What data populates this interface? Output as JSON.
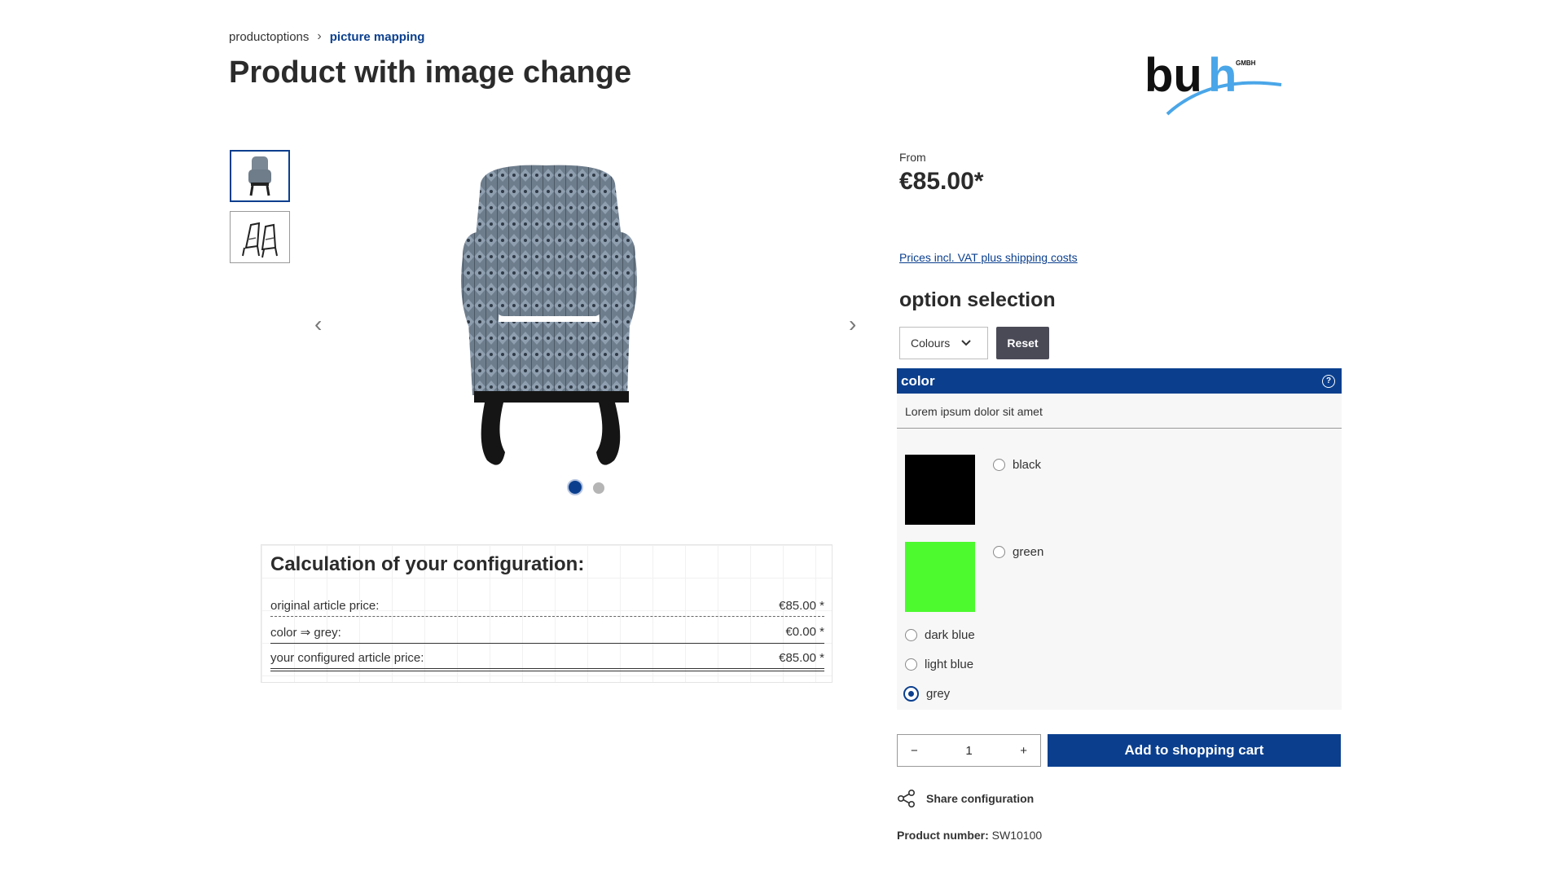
{
  "breadcrumb": {
    "parent": "productoptions",
    "current": "picture mapping"
  },
  "title": "Product with image change",
  "logo_text": {
    "main": "buh",
    "small": "GMBH"
  },
  "gallery": {
    "dots_total": 2,
    "active_dot": 1
  },
  "calculation": {
    "title": "Calculation of your configuration:",
    "rows": [
      {
        "label": "original article price:",
        "value": "€85.00 *"
      },
      {
        "label": "color ⇒ grey:",
        "value": "€0.00 *"
      },
      {
        "label": "your configured article price:",
        "value": "€85.00 *"
      }
    ]
  },
  "price": {
    "from_label": "From",
    "amount": "€85.00*",
    "vat_link": "Prices incl. VAT plus shipping costs"
  },
  "options": {
    "heading": "option selection",
    "select_value": "Colours",
    "reset_label": "Reset",
    "group_title": "color",
    "description": "Lorem ipsum dolor sit amet",
    "colors": [
      {
        "label": "black",
        "swatch": "#000000",
        "selected": false
      },
      {
        "label": "green",
        "swatch": "#4cfa2e",
        "selected": false
      },
      {
        "label": "dark blue",
        "selected": false
      },
      {
        "label": "light blue",
        "selected": false
      },
      {
        "label": "grey",
        "selected": true
      }
    ]
  },
  "quantity": {
    "value": "1",
    "minus": "−",
    "plus": "+"
  },
  "cart_button": "Add to shopping cart",
  "share_label": "Share configuration",
  "product_number": {
    "label": "Product number:",
    "value": "SW10100"
  },
  "colors": {
    "accent": "#0b3f8e",
    "reset_bg": "#4a4a57"
  }
}
